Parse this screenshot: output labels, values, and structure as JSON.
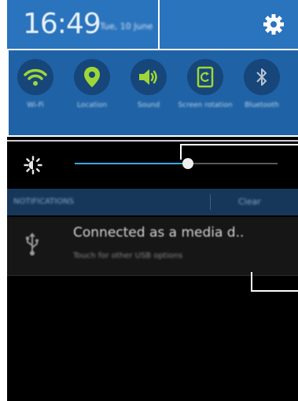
{
  "status": {
    "time": "16:49",
    "date": "Tue, 10 June"
  },
  "quick_settings": [
    {
      "label": "Wi-Fi",
      "icon": "wifi-icon",
      "active": true
    },
    {
      "label": "Location",
      "icon": "location-pin-icon",
      "active": true
    },
    {
      "label": "Sound",
      "icon": "speaker-icon",
      "active": true
    },
    {
      "label": "Screen rotation",
      "icon": "screen-rotation-icon",
      "active": true
    },
    {
      "label": "Bluetooth",
      "icon": "bluetooth-icon",
      "active": false
    }
  ],
  "brightness": {
    "level": 0.56
  },
  "notifications": {
    "header": "NOTIFICATIONS",
    "clear_label": "Clear",
    "items": [
      {
        "title": "Connected as a media d..",
        "subtitle": "Touch for other USB options",
        "icon": "usb-icon"
      }
    ]
  },
  "colors": {
    "active_icon": "#9fd636",
    "header_blue": "#2a73bd",
    "slider_blue": "#3aa7e6",
    "callout": "#ffffff"
  }
}
